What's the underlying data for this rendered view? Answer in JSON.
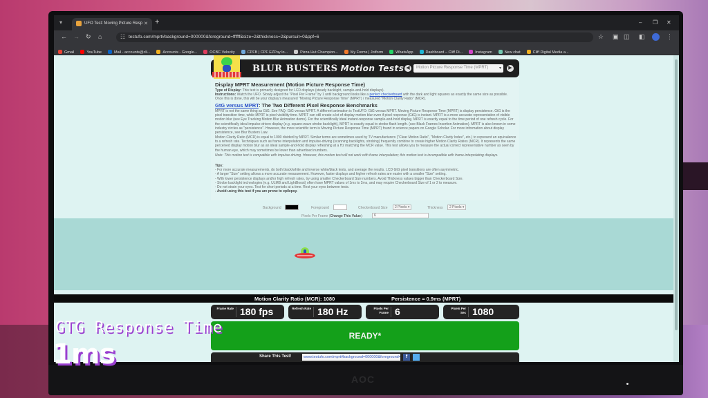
{
  "browser": {
    "tab_title": "UFO Test: Moving Picture Resp",
    "url": "testufo.com/mprt#background=000000&foreground=ffffff&size=2&thickness=2&pursuit=0&ppf=6",
    "window_controls": {
      "minimize": "–",
      "restore": "❐",
      "close": "✕"
    },
    "bookmarks": [
      {
        "label": "Gmail",
        "color": "#ea4335"
      },
      {
        "label": "YouTube",
        "color": "#ff0000"
      },
      {
        "label": "Mail - accounts@cli...",
        "color": "#0a64c8"
      },
      {
        "label": "Accounts - Google...",
        "color": "#f2b01e"
      },
      {
        "label": "OCBC Velocity",
        "color": "#e03c5e"
      },
      {
        "label": "CPFB | CPF EZPay lo...",
        "color": "#6fa8dc"
      },
      {
        "label": "Pizza Hut Champion...",
        "color": "#cccccc"
      },
      {
        "label": "My Forms | Jotform",
        "color": "#f07a2a"
      },
      {
        "label": "WhatsApp",
        "color": "#25d366"
      },
      {
        "label": "Dashboard – Cliff Di...",
        "color": "#1fb6d4"
      },
      {
        "label": "Instagram",
        "color": "#d046c8"
      },
      {
        "label": "New chat",
        "color": "#74c7b0"
      },
      {
        "label": "Cliff Digital Media a...",
        "color": "#f2b01e"
      }
    ]
  },
  "page": {
    "header": {
      "brand": "BLUR BUSTERS",
      "brand_suffix": "Motion Tests",
      "test_select": "Motion Picture Response Time (MPRT)",
      "prev_icon": "◀",
      "next_icon": "▶"
    },
    "title": "Display MPRT Measurement (Motion Picture Response Time)",
    "type_label": "Type of Display:",
    "type_text": "This test is primarily designed for LCD displays (steady backlight, sample-and-hold displays).",
    "instructions_label": "Instructions:",
    "instructions_text_1": "Watch the UFO. Slowly adjust the \"Pixel Per Frame\" by 1 until background looks like a",
    "instructions_link": "perfect checkerboard",
    "instructions_text_2": "with the dark and light squares as exactly the same size as possible. Once this is done, this will be your display's measured \"Moving Picture Response Time\" (MPRT) / measured \"Motion Clarity Ratio\" (MCR).",
    "section_link": "GtG versus MPRT",
    "section_title": "The Two Different Pixel Response Benchmarks",
    "section_para_1": "MPRT is not the same thing as GtG. See FAQ: GtG versus MPRT. A different animation is TestUFO: GtG versus MPRT. Moving Picture Response Time (MPRT) is display persistence. GtG is the pixel transition time, while MPRT is pixel visibility time. MPRT can still create a lot of display motion blur even if pixel response (GtG) is instant. MPRT is a more accurate representation of visible motion blur (see Eye Tracking Motion Blur Animation demo). For the scientifically ideal instant-response sample-and-hold display, MPRT is exactly equal to the time period of one refresh cycle. For the scientifically ideal impulse-driven display (e.g. square-wave strobe backlight), MPRT is exactly equal to strobe flash length. (see Black Frames Insertion Animation). MPRT is also known in some industry circles as \"persistence\". However, the more scientific term is Moving Picture Response Time (MPRT) found in science papers on Google Scholar. For more information about display persistence, see Blur Busters Law.",
    "section_para_2": "Motion Clarity Ratio (MCR) is equal to 1000 divided by MPRT. Similar terms are sometimes used by TV manufacturers (\"Clear Motion Ratio\", \"Motion Clarity Index\", etc.) to represent an equivalence to a refresh rate. Techniques such as frame interpolation and impulse-driving (scanning backlights, strobing) frequently combine to create higher Motion Clarity Ratios (MCR). It represents the same perceived display motion blur as an ideal sample-and-hold display refreshing at a Hz matching the MCR value. This test allows you to measure the actual correct representative number as seen by the human eye, which may sometimes be lower than advertised numbers.",
    "section_note": "Note: This motion test is compatible with impulse driving. However, this motion test will not work with frame interpolation; this motion test is incompatible with frame-interpolating displays.",
    "tips_label": "Tips:",
    "tips": [
      "- For more accurate measurements, do both black/white and inverse white/black tests, and average the results. LCD GtG pixel transitions are often asymmetric.",
      "- A larger \"Size\" setting allows a more accurate measurement. However, faster displays and higher refresh rates are easier with a smaller \"Size\" setting.",
      "- With lower persistence displays and/or high refresh rates, try using smaller Checkerboard Size numbers. Avoid Thickness values bigger than Checkerboard Size.",
      "- Strobe backlight technologies (e.g. ULMB and LightBoost) often have MPRT values of 1ms to 2ms, and may require Checkerboard Size of 1 or 2 to measure.",
      "- Do not strain your eyes. Test for short periods at a time. Rest your eyes between tests."
    ],
    "warning": "- Avoid using this test if you are prone to epilepsy.",
    "controls": {
      "background_label": "Background",
      "background_color": "#000000",
      "foreground_label": "Foreground",
      "foreground_color": "#ffffff",
      "checkerboard_label": "Checkerboard Size",
      "checkerboard_value": "2 Pixels ▾",
      "thickness_label": "Thickness",
      "thickness_value": "2 Pixels ▾",
      "ppf_label": "Pixels Per Frame (",
      "ppf_label_bold": "Change This Value",
      "ppf_label_end": "):",
      "ppf_value": "6"
    },
    "mcr_text": "Motion Clarity Ratio (MCR): 1080",
    "persistence_text": "Persistence = 0.9ms (MPRT)",
    "stats": [
      {
        "label": "Frame Rate",
        "value": "180 fps"
      },
      {
        "label": "Refresh Rate",
        "value": "180 Hz"
      },
      {
        "label": "Pixels Per Frame",
        "value": "6"
      },
      {
        "label": "Pixels Per Sec",
        "value": "1080"
      }
    ],
    "status": "READY*",
    "share_label": "Share This Test!",
    "share_url": "www.testufo.com/mprt#background=000000&foreground=",
    "facebook_label": "f"
  },
  "overlay": {
    "line1": "GTG Response Time",
    "line2": "1ms"
  },
  "monitor_brand": "AOC"
}
